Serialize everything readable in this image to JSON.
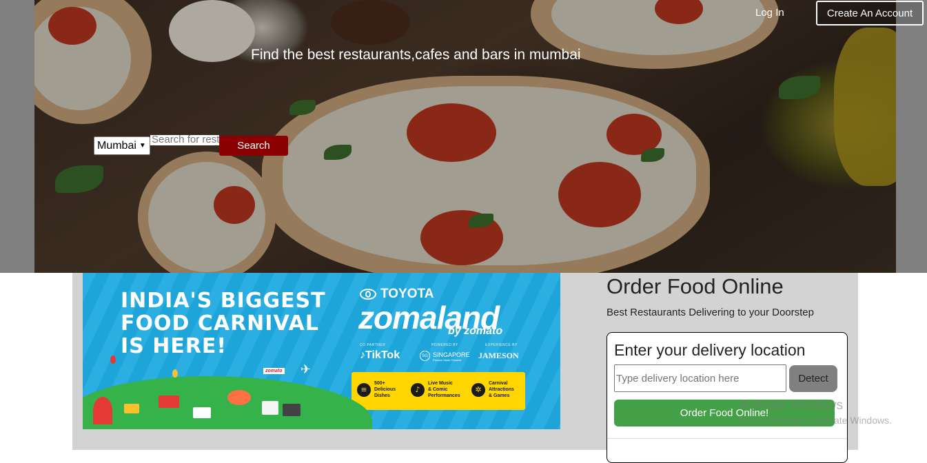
{
  "header": {
    "tagline": "Find the best restaurants,cafes and bars in mumbai",
    "login_label": "Log In",
    "create_account_label": "Create An Account"
  },
  "search": {
    "city_selected": "Mumbai",
    "placeholder": "Search for restaurants",
    "button_label": "Search"
  },
  "banner": {
    "headline": [
      "INDIA'S BIGGEST",
      "FOOD CARNIVAL",
      "IS HERE!"
    ],
    "sponsor_brand": "TOYOTA",
    "brand": "zomaland",
    "byline": "by zomato",
    "partner_captions": [
      "CO PARTNER",
      "POWERED BY",
      "EXPERIENCE BY"
    ],
    "partners": [
      "TikTok",
      "SINGAPORE",
      "JAMESON"
    ],
    "partner_sub": "Passion Made Possible",
    "sg_badge": "SG",
    "features": [
      {
        "icon": "burger-icon",
        "glyph": "≡",
        "text": [
          "500+",
          "Delicious",
          "Dishes"
        ]
      },
      {
        "icon": "microphone-icon",
        "glyph": "♪",
        "text": [
          "Live Music",
          "& Comic",
          "Performances"
        ]
      },
      {
        "icon": "ferris-wheel-icon",
        "glyph": "✲",
        "text": [
          "Carnival",
          "Attractions",
          "& Games"
        ]
      }
    ],
    "tag": "zomato"
  },
  "order": {
    "title": "Order Food Online",
    "subtitle": "Best Restaurants Delivering to your Doorstep",
    "card_title": "Enter your delivery location",
    "location_placeholder": "Type delivery location here",
    "detect_label": "Detect",
    "order_button_label": "Order Food Online!"
  },
  "watermark": {
    "line1": "Activate Windows",
    "line2": "Go to Settings to activate Windows."
  }
}
